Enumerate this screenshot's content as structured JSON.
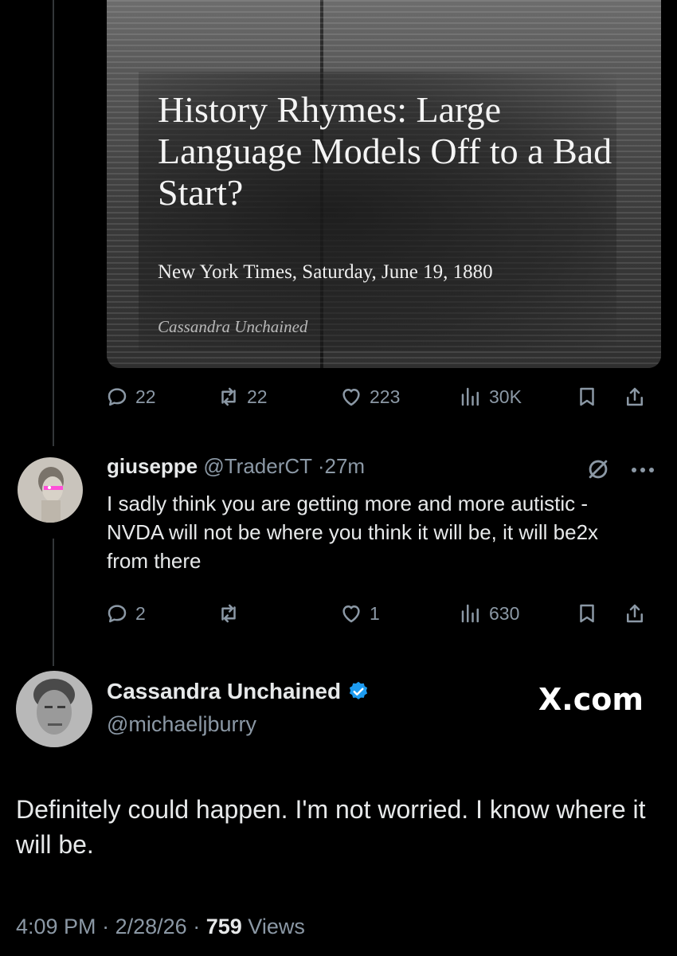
{
  "card": {
    "title": "History Rhymes: Large Language Models Off to a Bad Start?",
    "source": "New York Times, Saturday, June 19, 1880",
    "author": "Cassandra Unchained"
  },
  "tweet1_actions": {
    "replies": "22",
    "reposts": "22",
    "likes": "223",
    "views": "30K"
  },
  "reply": {
    "name": "giuseppe",
    "handle": "@TraderCT",
    "separator": "·",
    "time": "27m",
    "text": "I sadly think you are getting more and more autistic - NVDA will not be where you think it will be, it will be2x from there",
    "actions": {
      "replies": "2",
      "reposts": "",
      "likes": "1",
      "views": "630"
    }
  },
  "main": {
    "name": "Cassandra Unchained",
    "handle": "@michaeljburry",
    "brand": "X.com",
    "text": "Definitely could happen. I'm not worried. I know where it will be.",
    "time": "4:09 PM",
    "date": "2/28/26",
    "views_count": "759",
    "views_label": "Views",
    "separator": "·"
  },
  "colors": {
    "background": "#000000",
    "text": "#e7e9ea",
    "secondary": "#8b98a5",
    "verified": "#1d9bf0"
  },
  "icons": [
    "reply-icon",
    "repost-icon",
    "like-icon",
    "views-icon",
    "bookmark-icon",
    "share-icon",
    "grok-icon",
    "more-icon",
    "verified-badge-icon"
  ]
}
